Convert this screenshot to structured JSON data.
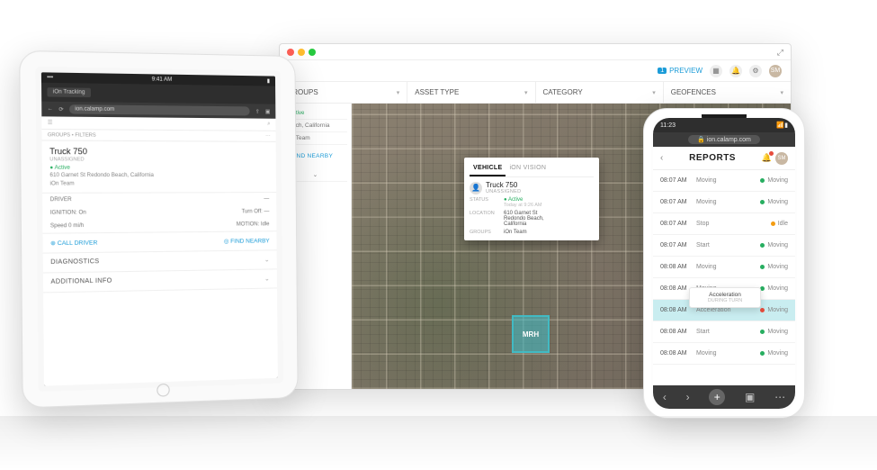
{
  "desktop": {
    "toolbar": {
      "preview_count": "1",
      "preview_label": "PREVIEW",
      "avatar": "SM"
    },
    "filters": {
      "groups": "GROUPS",
      "asset_type": "ASSET TYPE",
      "category": "CATEGORY",
      "geofences": "GEOFENCES"
    },
    "sidepanel": {
      "status_label": "Active",
      "location": "Beach, California",
      "group": "iOn Team",
      "find_nearby": "FIND NEARBY"
    },
    "callout": {
      "tab_vehicle": "VEHICLE",
      "tab_vision": "iON VISION",
      "title": "Truck 750",
      "subtitle": "UNASSIGNED",
      "status_k": "STATUS",
      "status_v": "Active",
      "status_time": "Today at 9:26 AM",
      "location_k": "LOCATION",
      "location_v": "610 Garnet St\nRedondo Beach,\nCalifornia",
      "groups_k": "GROUPS",
      "groups_v": "iOn Team"
    },
    "marker": "MRH"
  },
  "tablet": {
    "status_time": "9:41 AM",
    "tab_label": "iOn Tracking",
    "url": "ion.calamp.com",
    "filter_label": "GROUPS • FILTERS",
    "card": {
      "title": "Truck 750",
      "subtitle": "UNASSIGNED",
      "status_label": "Active",
      "location": "610 Garnet St Redondo Beach, California",
      "group": "iOn Team",
      "driver_label": "DRIVER",
      "ignition_on": "IGNITION: On",
      "motion": "MOTION: Idle",
      "speed": "Speed 0 mi/h",
      "turn": "Turn Off: —"
    },
    "action_left": "CALL DRIVER",
    "action_right": "FIND NEARBY",
    "acc_diag": "DIAGNOSTICS",
    "acc_info": "ADDITIONAL INFO"
  },
  "phone": {
    "status_time": "11:23",
    "url": "ion.calamp.com",
    "title": "REPORTS",
    "avatar": "SM",
    "tooltip_top": "Acceleration",
    "tooltip_bottom": "DURING TURN",
    "rows": [
      {
        "time": "08:07 AM",
        "event": "Moving",
        "status": "Moving",
        "dot": "sd-green"
      },
      {
        "time": "08:07 AM",
        "event": "Moving",
        "status": "Moving",
        "dot": "sd-green"
      },
      {
        "time": "08:07 AM",
        "event": "Stop",
        "status": "Idle",
        "dot": "sd-amber"
      },
      {
        "time": "08:07 AM",
        "event": "Start",
        "status": "Moving",
        "dot": "sd-green"
      },
      {
        "time": "08:08 AM",
        "event": "Moving",
        "status": "Moving",
        "dot": "sd-green"
      },
      {
        "time": "08:08 AM",
        "event": "Moving",
        "status": "Moving",
        "dot": "sd-green"
      },
      {
        "time": "08:08 AM",
        "event": "Acceleration",
        "status": "Moving",
        "dot": "sd-red",
        "active": true
      },
      {
        "time": "08:08 AM",
        "event": "Start",
        "status": "Moving",
        "dot": "sd-green"
      },
      {
        "time": "08:08 AM",
        "event": "Moving",
        "status": "Moving",
        "dot": "sd-green"
      }
    ]
  }
}
